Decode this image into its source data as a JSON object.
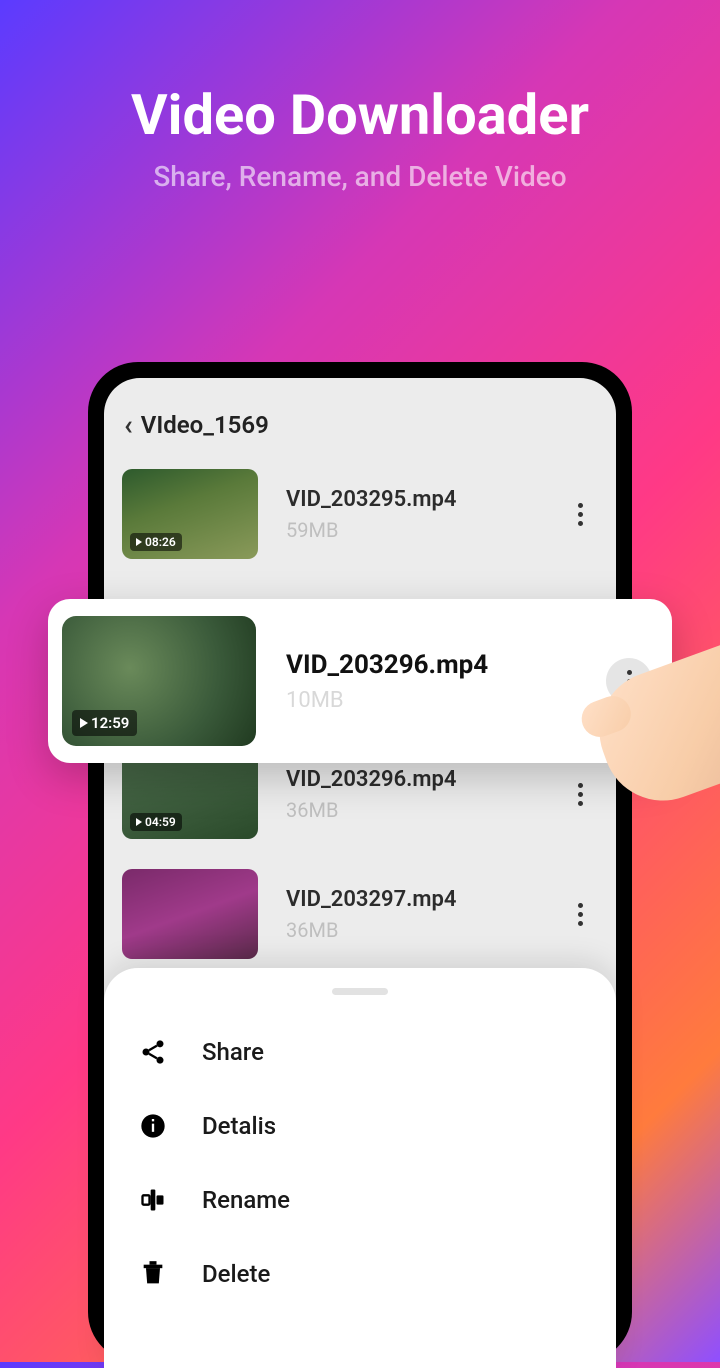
{
  "hero": {
    "title": "Video Downloader",
    "subtitle": "Share, Rename, and Delete Video"
  },
  "header": {
    "back_label": "VIdeo_1569"
  },
  "videos": [
    {
      "name": "VID_203295.mp4",
      "size": "59MB",
      "duration": "08:26"
    },
    {
      "name": "VID_203296.mp4",
      "size": "10MB",
      "duration": "12:59"
    },
    {
      "name": "VID_203296.mp4",
      "size": "36MB",
      "duration": "04:59"
    },
    {
      "name": "VID_203297.mp4",
      "size": "36MB",
      "duration": ""
    }
  ],
  "menu": {
    "share": "Share",
    "details": "Detalis",
    "rename": "Rename",
    "delete": "Delete"
  }
}
